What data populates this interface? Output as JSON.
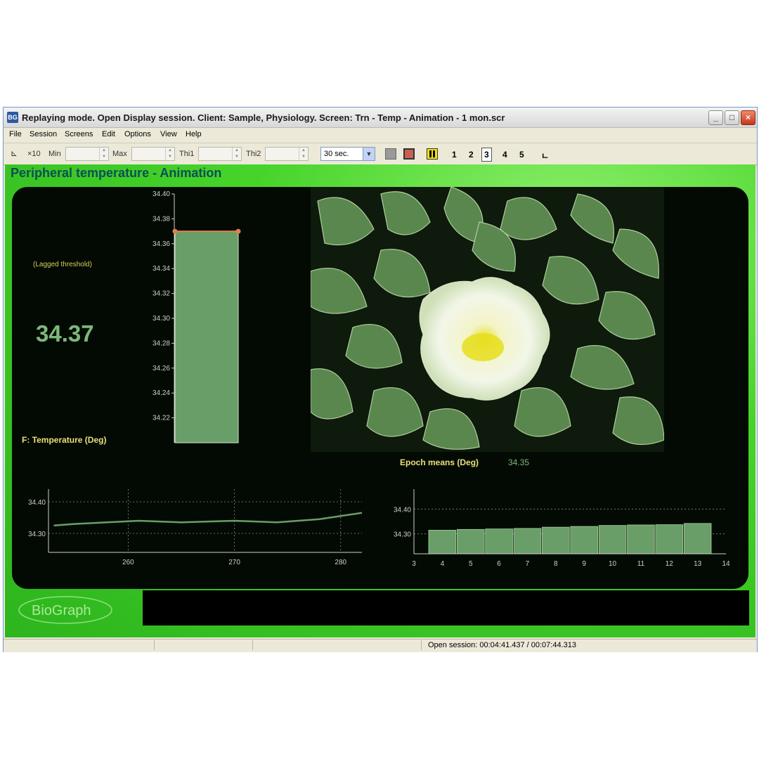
{
  "window": {
    "title": "Replaying mode. Open Display session. Client: Sample, Physiology. Screen: Trn - Temp - Animation - 1 mon.scr",
    "app_icon_text": "BG"
  },
  "menu": [
    "File",
    "Session",
    "Screens",
    "Edit",
    "Options",
    "View",
    "Help"
  ],
  "toolbar": {
    "zoom_label": "×10",
    "min_label": "Min",
    "max_label": "Max",
    "thi1_label": "Thi1",
    "thi2_label": "Thi2",
    "duration_value": "30 sec.",
    "pages": [
      "1",
      "2",
      "3",
      "4",
      "5"
    ],
    "active_page": "3"
  },
  "screen": {
    "title": "Peripheral temperature - Animation",
    "lagged_threshold_label": "(Lagged threshold)",
    "current_value": "34.37",
    "channel_label": "F: Temperature (Deg)",
    "epoch_label": "Epoch means (Deg)",
    "epoch_value": "34.35",
    "logo_text": "BioGraph"
  },
  "status": {
    "session_text": "Open session: 00:04:41.437 / 00:07:44.313"
  },
  "colors": {
    "bar_fill": "#6a9e68",
    "threshold": "#e08050",
    "panel_bg": "#030a03",
    "accent_green": "#47d42a"
  },
  "chart_data": [
    {
      "type": "bar",
      "categories": [
        "F"
      ],
      "values": [
        34.37
      ],
      "threshold": 34.37,
      "ylim": [
        34.2,
        34.4
      ],
      "yticks": [
        "34.40",
        "34.38",
        "34.36",
        "34.34",
        "34.32",
        "34.30",
        "34.28",
        "34.26",
        "34.24",
        "34.22"
      ],
      "xlabel": "",
      "ylabel": ""
    },
    {
      "type": "line",
      "x": [
        253,
        255,
        258,
        261,
        265,
        270,
        274,
        278,
        282
      ],
      "values": [
        34.325,
        34.33,
        34.335,
        34.34,
        34.335,
        34.34,
        34.335,
        34.345,
        34.365
      ],
      "xlim": [
        252.5,
        282
      ],
      "ylim": [
        34.24,
        34.44
      ],
      "xticks": [
        "260",
        "270",
        "280"
      ],
      "yticks": [
        "34.40",
        "34.30"
      ],
      "xlabel": "",
      "ylabel": ""
    },
    {
      "type": "bar",
      "categories": [
        "4",
        "5",
        "6",
        "7",
        "8",
        "9",
        "10",
        "11",
        "12",
        "13"
      ],
      "values": [
        34.315,
        34.318,
        34.32,
        34.322,
        34.327,
        34.33,
        34.334,
        34.336,
        34.337,
        34.342
      ],
      "xlim": [
        3,
        14
      ],
      "ylim": [
        34.22,
        34.48
      ],
      "xticks": [
        "3",
        "4",
        "5",
        "6",
        "7",
        "8",
        "9",
        "10",
        "11",
        "12",
        "13",
        "14"
      ],
      "yticks": [
        "34.40",
        "34.30"
      ],
      "xlabel": "",
      "ylabel": ""
    }
  ]
}
